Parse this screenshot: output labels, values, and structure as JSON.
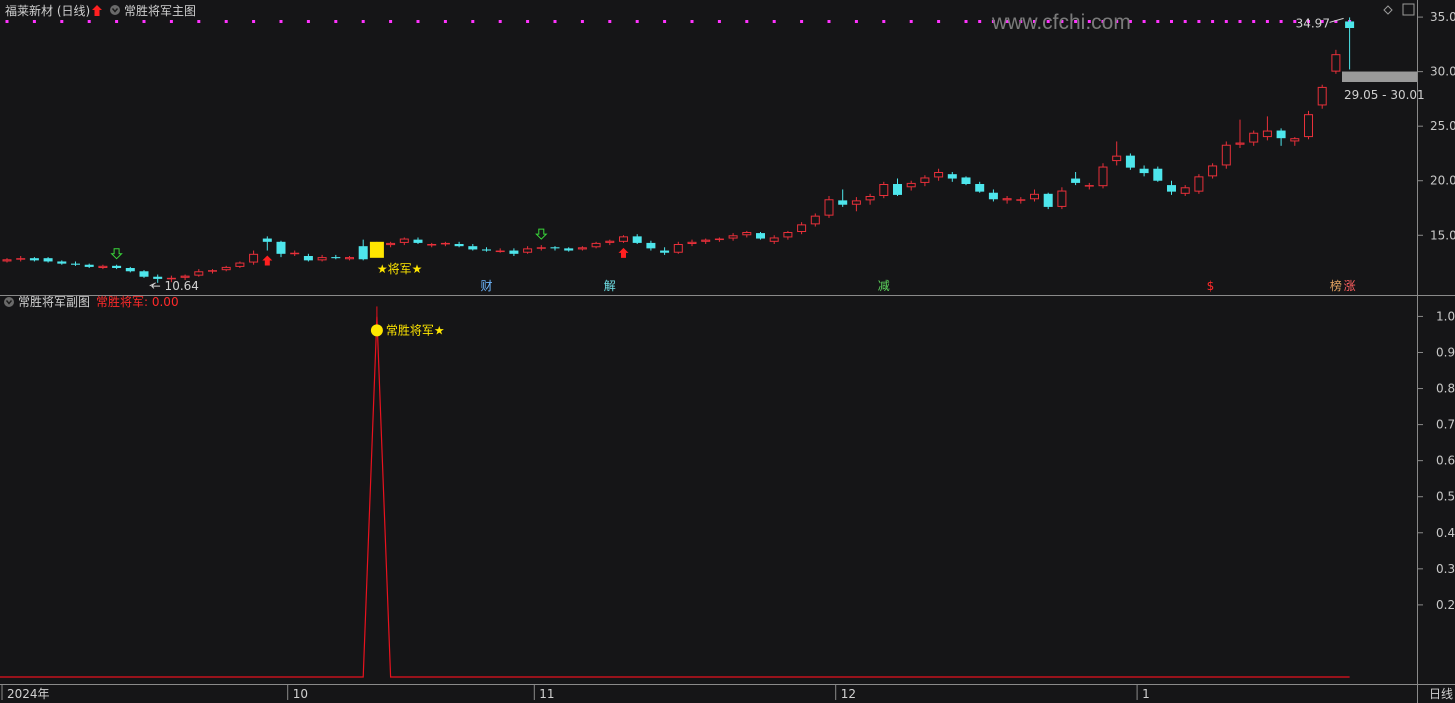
{
  "main_header": {
    "stock_name": "福莱新材 (日线)",
    "indicator_name": "常胜将军主图"
  },
  "sub_header": {
    "indicator_name": "常胜将军副图",
    "value_label": "常胜将军: 0.00"
  },
  "watermark": "www.cfchi.com",
  "period_label": "日线",
  "colors": {
    "up": "#e8303a",
    "down": "#4ee6ec",
    "dots": "#ff33ff",
    "marker": "#ffe600",
    "line": "#e8121e"
  },
  "chart_data": [
    {
      "type": "candlestick",
      "title": "常胜将军主图",
      "ylim": [
        9.8,
        36.2
      ],
      "y_ticks": [
        "35.0",
        "30.0",
        "25.0",
        "20.0",
        "15.0"
      ],
      "x_ticks": [
        "2024年",
        "10",
        "11",
        "12",
        "1"
      ],
      "x_tick_index": [
        0,
        21,
        39,
        61,
        83
      ],
      "ohlc": [
        [
          12.6,
          12.9,
          12.5,
          12.8
        ],
        [
          12.8,
          13.1,
          12.6,
          12.9
        ],
        [
          12.9,
          13.0,
          12.6,
          12.7
        ],
        [
          12.9,
          13.0,
          12.5,
          12.6
        ],
        [
          12.6,
          12.7,
          12.3,
          12.4
        ],
        [
          12.4,
          12.6,
          12.2,
          12.3
        ],
        [
          12.3,
          12.4,
          12.0,
          12.1
        ],
        [
          12.0,
          12.3,
          11.9,
          12.2
        ],
        [
          12.2,
          12.3,
          11.9,
          12.0
        ],
        [
          12.0,
          12.1,
          11.6,
          11.7
        ],
        [
          11.7,
          11.8,
          11.1,
          11.2
        ],
        [
          11.2,
          11.4,
          10.64,
          11.0
        ],
        [
          11.0,
          11.3,
          10.7,
          11.1
        ],
        [
          11.1,
          11.4,
          10.9,
          11.3
        ],
        [
          11.3,
          11.9,
          11.2,
          11.7
        ],
        [
          11.7,
          11.9,
          11.5,
          11.8
        ],
        [
          11.8,
          12.2,
          11.7,
          12.1
        ],
        [
          12.1,
          12.6,
          12.0,
          12.5
        ],
        [
          12.5,
          13.6,
          12.3,
          13.3
        ],
        [
          14.7,
          14.9,
          13.6,
          14.4
        ],
        [
          14.4,
          14.5,
          13.0,
          13.3
        ],
        [
          13.3,
          13.6,
          13.1,
          13.4
        ],
        [
          13.1,
          13.3,
          12.6,
          12.7
        ],
        [
          12.7,
          13.2,
          12.6,
          13.0
        ],
        [
          13.0,
          13.2,
          12.8,
          12.9
        ],
        [
          12.8,
          13.1,
          12.7,
          13.0
        ],
        [
          14.0,
          14.6,
          12.7,
          12.8
        ],
        [
          14.0,
          14.4,
          13.9,
          14.2
        ],
        [
          14.1,
          14.4,
          13.9,
          14.3
        ],
        [
          14.3,
          14.8,
          14.1,
          14.7
        ],
        [
          14.6,
          14.8,
          14.2,
          14.3
        ],
        [
          14.1,
          14.3,
          13.9,
          14.2
        ],
        [
          14.2,
          14.4,
          14.0,
          14.3
        ],
        [
          14.2,
          14.4,
          13.9,
          14.0
        ],
        [
          14.0,
          14.2,
          13.6,
          13.7
        ],
        [
          13.7,
          13.9,
          13.5,
          13.6
        ],
        [
          13.5,
          13.8,
          13.4,
          13.6
        ],
        [
          13.6,
          13.8,
          13.1,
          13.3
        ],
        [
          13.4,
          14.0,
          13.3,
          13.8
        ],
        [
          13.8,
          14.1,
          13.6,
          13.9
        ],
        [
          13.9,
          14.0,
          13.6,
          13.8
        ],
        [
          13.8,
          13.9,
          13.5,
          13.6
        ],
        [
          13.7,
          14.0,
          13.6,
          13.9
        ],
        [
          13.9,
          14.4,
          13.8,
          14.3
        ],
        [
          14.3,
          14.6,
          14.1,
          14.5
        ],
        [
          14.4,
          15.0,
          14.3,
          14.9
        ],
        [
          14.9,
          15.1,
          14.2,
          14.3
        ],
        [
          14.3,
          14.5,
          13.6,
          13.8
        ],
        [
          13.6,
          13.9,
          13.2,
          13.4
        ],
        [
          13.4,
          14.4,
          13.3,
          14.2
        ],
        [
          14.2,
          14.6,
          14.0,
          14.4
        ],
        [
          14.4,
          14.7,
          14.2,
          14.6
        ],
        [
          14.6,
          14.8,
          14.4,
          14.7
        ],
        [
          14.7,
          15.2,
          14.5,
          15.0
        ],
        [
          15.0,
          15.4,
          14.8,
          15.3
        ],
        [
          15.2,
          15.3,
          14.6,
          14.7
        ],
        [
          14.4,
          15.0,
          14.2,
          14.8
        ],
        [
          14.8,
          15.4,
          14.6,
          15.3
        ],
        [
          15.3,
          16.2,
          15.1,
          16.0
        ],
        [
          16.0,
          17.0,
          15.8,
          16.8
        ],
        [
          16.8,
          18.6,
          16.6,
          18.3
        ],
        [
          18.2,
          19.2,
          17.6,
          17.8
        ],
        [
          17.8,
          18.5,
          17.2,
          18.2
        ],
        [
          18.2,
          18.8,
          17.8,
          18.6
        ],
        [
          18.6,
          19.9,
          18.4,
          19.7
        ],
        [
          19.7,
          20.2,
          18.6,
          18.7
        ],
        [
          19.4,
          20.0,
          19.1,
          19.8
        ],
        [
          19.8,
          20.5,
          19.5,
          20.3
        ],
        [
          20.3,
          21.1,
          20.0,
          20.8
        ],
        [
          20.6,
          20.8,
          19.9,
          20.2
        ],
        [
          20.3,
          20.4,
          19.6,
          19.7
        ],
        [
          19.7,
          19.9,
          18.9,
          19.0
        ],
        [
          18.9,
          19.2,
          18.1,
          18.3
        ],
        [
          18.2,
          18.6,
          17.9,
          18.4
        ],
        [
          18.2,
          18.5,
          17.9,
          18.3
        ],
        [
          18.3,
          19.2,
          18.1,
          18.8
        ],
        [
          18.8,
          18.9,
          17.4,
          17.6
        ],
        [
          17.6,
          19.4,
          17.4,
          19.1
        ],
        [
          20.2,
          20.8,
          19.6,
          19.8
        ],
        [
          19.5,
          19.8,
          19.2,
          19.6
        ],
        [
          19.5,
          21.6,
          19.3,
          21.3
        ],
        [
          21.8,
          23.6,
          21.4,
          22.3
        ],
        [
          22.3,
          22.5,
          21.0,
          21.2
        ],
        [
          21.1,
          21.4,
          20.4,
          20.7
        ],
        [
          21.1,
          21.3,
          19.9,
          20.0
        ],
        [
          19.6,
          20.0,
          18.7,
          19.0
        ],
        [
          18.8,
          19.6,
          18.6,
          19.4
        ],
        [
          19.0,
          20.6,
          18.8,
          20.4
        ],
        [
          20.4,
          21.6,
          20.2,
          21.4
        ],
        [
          21.4,
          23.6,
          21.1,
          23.3
        ],
        [
          23.3,
          25.6,
          23.0,
          23.5
        ],
        [
          23.5,
          24.6,
          23.2,
          24.4
        ],
        [
          24.0,
          25.9,
          23.7,
          24.6
        ],
        [
          24.6,
          24.8,
          23.2,
          23.9
        ],
        [
          23.6,
          24.0,
          23.2,
          23.9
        ],
        [
          24.0,
          26.4,
          23.8,
          26.1
        ],
        [
          26.9,
          28.8,
          26.6,
          28.6
        ],
        [
          30.0,
          32.0,
          29.8,
          31.6
        ],
        [
          34.6,
          34.97,
          30.2,
          34.0
        ]
      ],
      "low_label": "10.64",
      "high_label": "34.97",
      "range_label": "29.05 - 30.01",
      "range": [
        29.05,
        30.01
      ],
      "marker_text": "★将军★",
      "marker_index": 27,
      "buy_arrows_index": [
        19,
        45
      ],
      "sell_arrows_index": [
        8,
        39
      ],
      "events": [
        {
          "label": "财",
          "index": 35
        },
        {
          "label": "解",
          "index": 44
        },
        {
          "label": "减",
          "index": 64
        },
        {
          "label": "$",
          "index": 88
        },
        {
          "label": "榜",
          "index": 97
        },
        {
          "label": "涨",
          "index": 98
        }
      ]
    },
    {
      "type": "line",
      "title": "常胜将军副图",
      "ylim": [
        0,
        1.04
      ],
      "y_ticks": [
        "1.0",
        "0.9",
        "0.8",
        "0.7",
        "0.6",
        "0.5",
        "0.4",
        "0.3",
        "0.2"
      ],
      "series": [
        {
          "values_desc": "spike",
          "peak_index": 27,
          "peak_value": 1.0,
          "base_value": 0.0
        }
      ],
      "marker_text": "常胜将军★"
    }
  ]
}
